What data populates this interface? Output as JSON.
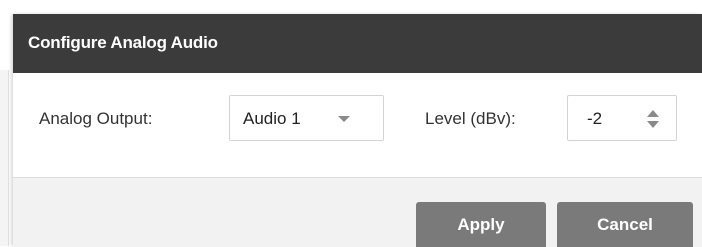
{
  "dialog": {
    "title": "Configure Analog Audio"
  },
  "fields": {
    "analog_output_label": "Analog Output:",
    "analog_output_value": "Audio 1",
    "level_label": "Level (dBv):",
    "level_value": "-2"
  },
  "buttons": {
    "apply": "Apply",
    "cancel": "Cancel"
  },
  "icons": {
    "select_arrow": "chevron-down-icon",
    "spinner_arrows": "spinner-arrows-icon"
  },
  "colors": {
    "titlebar": "#3b3b3b",
    "button": "#7a7a7a",
    "footer": "#f2f2f2"
  }
}
